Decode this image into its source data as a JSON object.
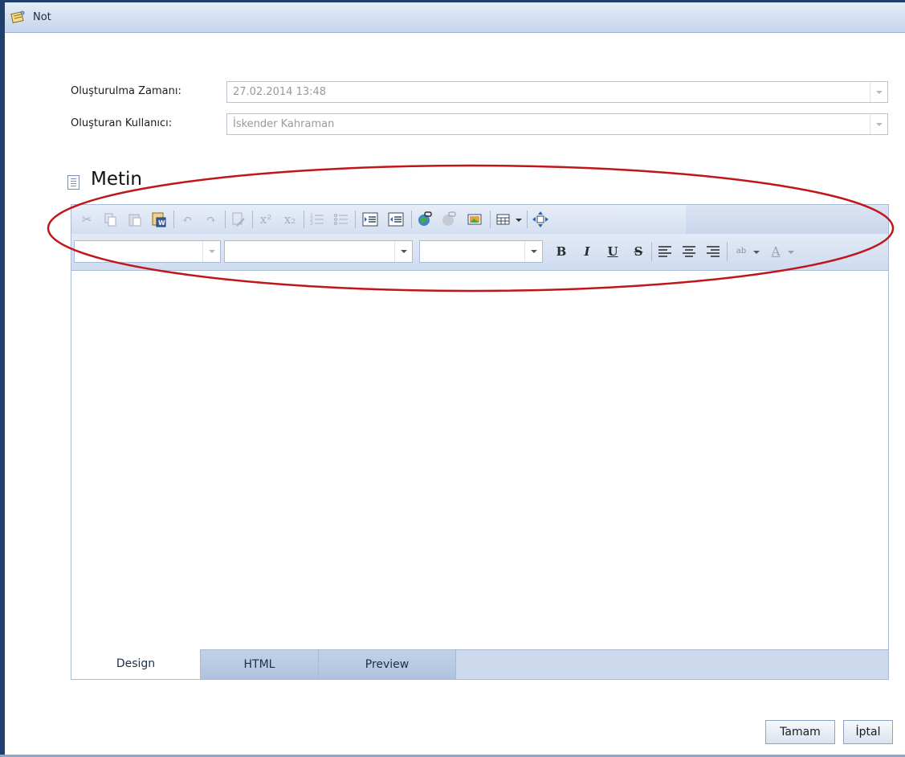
{
  "window": {
    "title": "Not",
    "title_icon": "note-icon"
  },
  "form": {
    "created_label": "Oluşturulma Zamanı:",
    "created_value": "27.02.2014 13:48",
    "creator_label": "Oluşturan Kullanıcı:",
    "creator_value": "İskender Kahraman"
  },
  "section": {
    "title": "Metin",
    "icon": "document-lines-icon"
  },
  "toolbar_row1": [
    "cut-icon",
    "copy-icon",
    "paste-icon",
    "paste-from-word-icon",
    "undo-icon",
    "redo-icon",
    "paste-plain-icon",
    "superscript-icon",
    "subscript-icon",
    "ordered-list-icon",
    "bullet-list-icon",
    "indent-icon",
    "outdent-icon",
    "insert-link-icon",
    "unlink-icon",
    "insert-image-icon",
    "insert-table-icon",
    "fullscreen-icon"
  ],
  "toolbar_row2": {
    "paragraph_select": "",
    "font_select": "",
    "size_select": "",
    "bold": "B",
    "italic": "I",
    "underline": "U",
    "strike": "S",
    "highlight_glyph": "ab",
    "forecolor_glyph": "A"
  },
  "tabs": [
    {
      "label": "Design",
      "active": true
    },
    {
      "label": "HTML",
      "active": false
    },
    {
      "label": "Preview",
      "active": false
    }
  ],
  "buttons": {
    "ok": "Tamam",
    "cancel": "İptal"
  },
  "colors": {
    "accent": "#1f3f6e",
    "annotation": "#c0161a",
    "toolbar": "#d3dff0"
  }
}
